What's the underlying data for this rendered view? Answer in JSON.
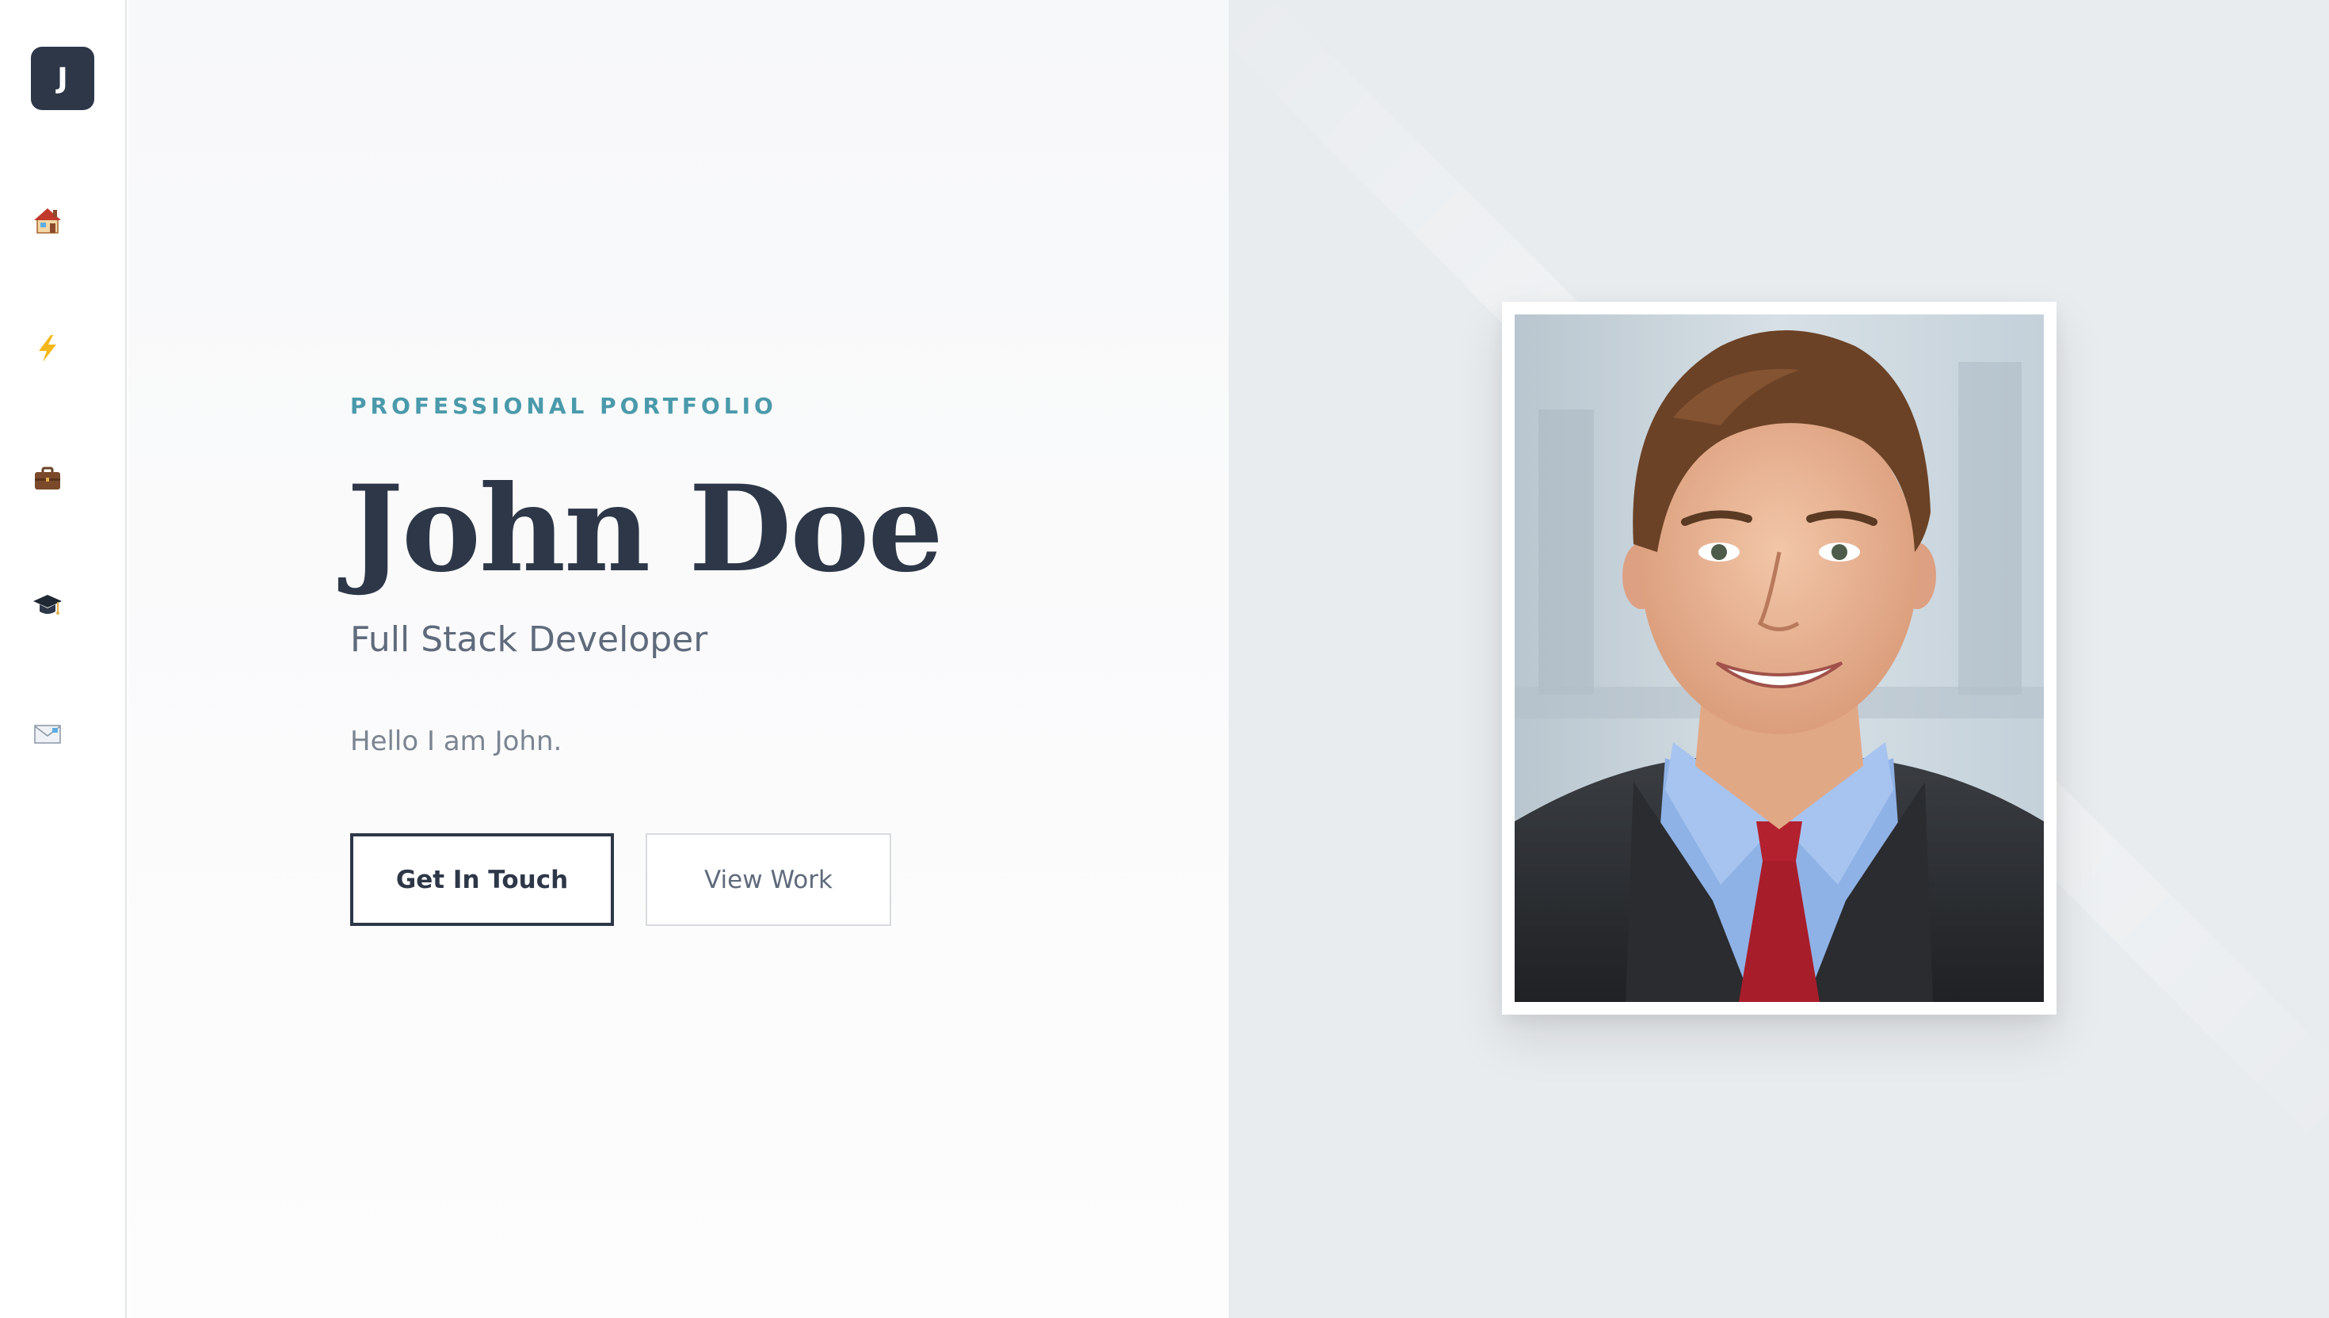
{
  "sidebar": {
    "logo_letter": "J",
    "items": [
      {
        "icon": "house-icon"
      },
      {
        "icon": "lightning-icon"
      },
      {
        "icon": "briefcase-icon"
      },
      {
        "icon": "graduation-cap-icon"
      },
      {
        "icon": "envelope-icon"
      }
    ]
  },
  "hero": {
    "eyebrow": "PROFESSIONAL PORTFOLIO",
    "name": "John Doe",
    "role": "Full Stack Developer",
    "intro": "Hello I am John.",
    "primary_button": "Get In Touch",
    "secondary_button": "View Work"
  },
  "colors": {
    "accent": "#4a9aab",
    "primary": "#2d3748",
    "right_panel": "#e9ecef"
  }
}
